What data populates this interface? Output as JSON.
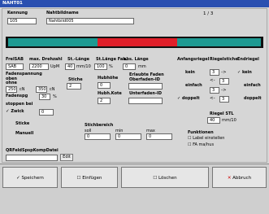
{
  "window": {
    "title": "NAHT01"
  },
  "header": {
    "kennung_label": "Kennung",
    "kennung_value": "105",
    "nahtbild_label": "Nahtbildname",
    "nahtbild_value": "Nahtbild005",
    "page_counter": "1 / 3"
  },
  "colors": {
    "teal": "#1e9a92",
    "red": "#e0202a",
    "black": "#111111"
  },
  "left": {
    "fretsab_label": "FrelSAB",
    "fretsab_value": "SAB",
    "drehzahl_label": "max. Drehzahl",
    "drehzahl_value": "2200",
    "drehzahl_unit": "UpM",
    "stlaenge_label": "St.-Länge",
    "stlaenge_value": "40",
    "stlaenge_unit": "mm/10",
    "stlfak_label": "St.Länge Fak.",
    "stlfak_value": "100",
    "stlfak_unit": "%",
    "abslaenge_label": "abs. Länge",
    "abslaenge_value": "0",
    "abslaenge_unit": "mm",
    "fadenspannung_label": "Fadenspannung\noben",
    "fadenspannung_label2": "ohne",
    "fadensp_val1": "250",
    "fadensp_unit1": "cN",
    "fadensp_val2": "350",
    "fadensp_unit2": "cN",
    "stiche_label": "Stiche",
    "stiche_value": "2",
    "hubhoehe_label": "Hubhöhe",
    "hubhoehe_value": "0",
    "erlaubte_label": "Erlaubte Faden\nOberfaden-ID",
    "fadenspg_label": "Fadenspg",
    "fadenspg_value": "30",
    "fadenspg_unit": "%",
    "hubh_kote_label": "Hubh.Kote",
    "hubh_kote_value": "2",
    "unterfaden_label": "Unterfaden-ID",
    "stoppen_label": "stoppen bei",
    "zwick_label": "Zwick",
    "zwick_value": "0",
    "sticke_label": "Sticke",
    "manuell_label": "Manuell",
    "stichbereich_label": "Stichbereich",
    "soll_label": "soll",
    "min_label": "min",
    "max_label": "max",
    "soll_value": "0",
    "min_value": "0",
    "max_value": "0",
    "qrcode_label": "QRFeldSpspKompDatei",
    "edit_label": "Edit"
  },
  "right": {
    "anfangsriegel_label": "Anfangsriegel",
    "riegelstiche_label": "Riegelstiche",
    "endriegel_label": "Endriegel",
    "kein_label": "kein",
    "einfach_label": "einfach",
    "doppelt_label": "doppelt",
    "kein2_label": "kein",
    "einfach2_label": "einfach",
    "doppelt2_label": "doppelt",
    "rs_vals": [
      "3",
      "3",
      "3",
      "3"
    ],
    "arrows": [
      "<-",
      "->",
      "<-",
      "->"
    ],
    "riegelstl_label": "Riegel STL",
    "riegelstl_value": "40",
    "riegelstl_unit": "mm/10",
    "funktionen_label": "Funktionen",
    "label_einstellen": "Label einstellen",
    "fa_meinus": "FA ma/hus"
  },
  "footer": {
    "speichern": "Speichern",
    "einfuegen": "Einfügen",
    "loeschen": "Löschen",
    "abbruch": "Abbruch"
  }
}
